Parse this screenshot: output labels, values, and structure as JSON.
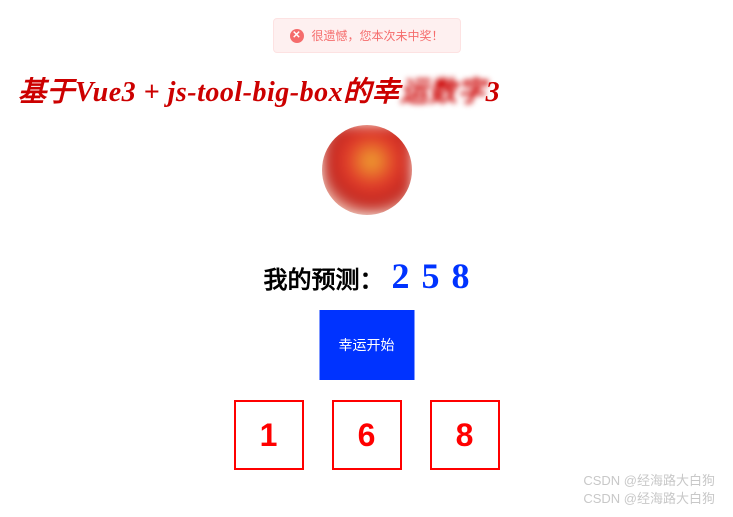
{
  "alert": {
    "message": "很遗憾，您本次未中奖！"
  },
  "title": {
    "prefix": "基于",
    "main": "Vue3 + js-tool-big-box",
    "suffix_visible": "的幸",
    "suffix_blurred": "运数字",
    "tail": "3"
  },
  "predict": {
    "label": "我的预测：",
    "nums": [
      "2",
      "5",
      "8"
    ]
  },
  "button": {
    "start": "幸运开始"
  },
  "result": {
    "nums": [
      "1",
      "6",
      "8"
    ]
  },
  "watermark": {
    "text": "CSDN @经海路大白狗"
  },
  "colors": {
    "title": "#cc0000",
    "predict_num": "#0033ff",
    "button_bg": "#0033ff",
    "result_border": "#ff0000",
    "result_text": "#ff0000",
    "alert_bg": "#fef0f0",
    "alert_text": "#f56c6c"
  }
}
